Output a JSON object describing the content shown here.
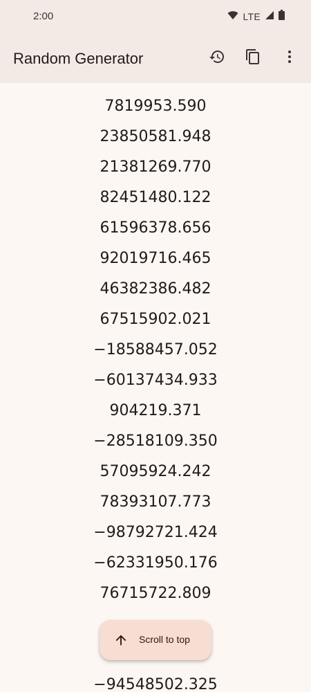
{
  "status_bar": {
    "time": "2:00",
    "network": "LTE"
  },
  "app_bar": {
    "title": "Random Generator",
    "actions": [
      "history-icon",
      "copy-icon",
      "more-vert-icon"
    ]
  },
  "numbers": [
    "7819953.590",
    "23850581.948",
    "21381269.770",
    "82451480.122",
    "61596378.656",
    "92019716.465",
    "46382386.482",
    "67515902.021",
    "−18588457.052",
    "−60137434.933",
    "904219.371",
    "−28518109.350",
    "57095924.242",
    "78393107.773",
    "−98792721.424",
    "−62331950.176",
    "76715722.809",
    "",
    "",
    "−94548502.325"
  ],
  "fab": {
    "label": "Scroll to top",
    "icon": "arrow-up-icon"
  },
  "colors": {
    "background": "#FDF7F4",
    "app_bar": "#F3EAE6",
    "fab_container": "#F8DDD3",
    "on_surface": "#201A18"
  }
}
